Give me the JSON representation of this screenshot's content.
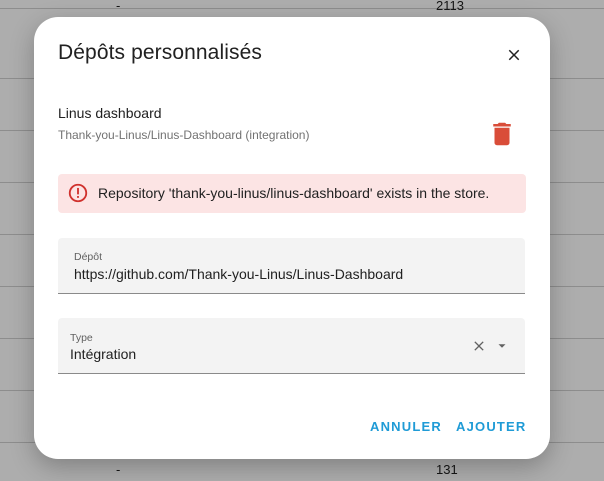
{
  "background": {
    "top_row": {
      "left_cell": "-",
      "right_cell": "2113"
    },
    "bottom_row": {
      "left_cell": "-",
      "right_cell": "131"
    }
  },
  "dialog": {
    "title": "Dépôts personnalisés",
    "close_icon": "close-icon",
    "repository": {
      "name": "Linus dashboard",
      "subtitle": "Thank-you-Linus/Linus-Dashboard (integration)",
      "delete_icon": "trash-icon",
      "delete_color": "#d94d39"
    },
    "alert": {
      "icon": "alert-circle-icon",
      "message": "Repository 'thank-you-linus/linus-dashboard' exists in the store.",
      "background": "#fce4e4",
      "icon_color": "#d0312d"
    },
    "repo_field": {
      "label": "Dépôt",
      "value": "https://github.com/Thank-you-Linus/Linus-Dashboard"
    },
    "type_field": {
      "label": "Type",
      "value": "Intégration",
      "clear_icon": "close-icon",
      "dropdown_icon": "caret-down-icon"
    },
    "actions": {
      "cancel_label": "ANNULER",
      "add_label": "AJOUTER",
      "accent": "#1f9bd6"
    }
  }
}
